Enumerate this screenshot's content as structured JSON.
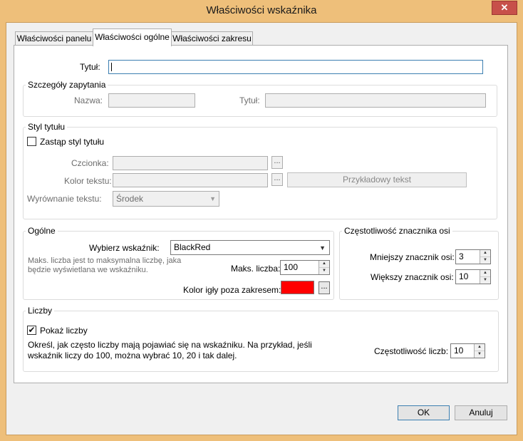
{
  "window": {
    "title": "Właściwości wskaźnika",
    "close_glyph": "✕"
  },
  "tabs": [
    {
      "label": "Właściwości panelu"
    },
    {
      "label": "Właściwości ogólne"
    },
    {
      "label": "Właściwości zakresu"
    }
  ],
  "title_field": {
    "label": "Tytuł:",
    "value": ""
  },
  "query_details": {
    "legend": "Szczegóły zapytania",
    "name_label": "Nazwa:",
    "name_value": "",
    "title_label": "Tytuł:",
    "title_value": ""
  },
  "title_style": {
    "legend": "Styl tytułu",
    "override_label": "Zastąp styl tytułu",
    "override_checked": false,
    "font_label": "Czcionka:",
    "text_color_label": "Kolor tekstu:",
    "sample_button": "Przykładowy tekst",
    "align_label": "Wyrównanie tekstu:",
    "align_value": "Środek",
    "ellipsis": "..."
  },
  "general": {
    "legend": "Ogólne",
    "select_gauge_label": "Wybierz wskaźnik:",
    "select_gauge_value": "BlackRed",
    "help_text_1": "Maks. liczba jest to maksymalna liczbę, jaka",
    "help_text_2": "będzie wyświetlana we wskaźniku.",
    "max_label": "Maks. liczba:",
    "max_value": "100",
    "needle_color_label": "Kolor igły poza zakresem:",
    "needle_color": "#ff0000",
    "ellipsis": "..."
  },
  "axis_ticks": {
    "legend": "Częstotliwość znacznika osi",
    "minor_label": "Mniejszy znacznik osi:",
    "minor_value": "3",
    "major_label": "Większy znacznik osi:",
    "major_value": "10"
  },
  "numbers": {
    "legend": "Liczby",
    "show_label": "Pokaż liczby",
    "show_checked": true,
    "help_1": "Określ, jak często liczby mają pojawiać się na wskaźniku. Na przykład, jeśli",
    "help_2": "wskaźnik liczy do 100, można wybrać 10, 20 i tak dalej.",
    "freq_label": "Częstotliwość liczb:",
    "freq_value": "10"
  },
  "buttons": {
    "ok": "OK",
    "cancel": "Anuluj"
  },
  "colors": {
    "frame": "#eebf7a",
    "close": "#c7504a",
    "accent": "#3c7fb1"
  }
}
